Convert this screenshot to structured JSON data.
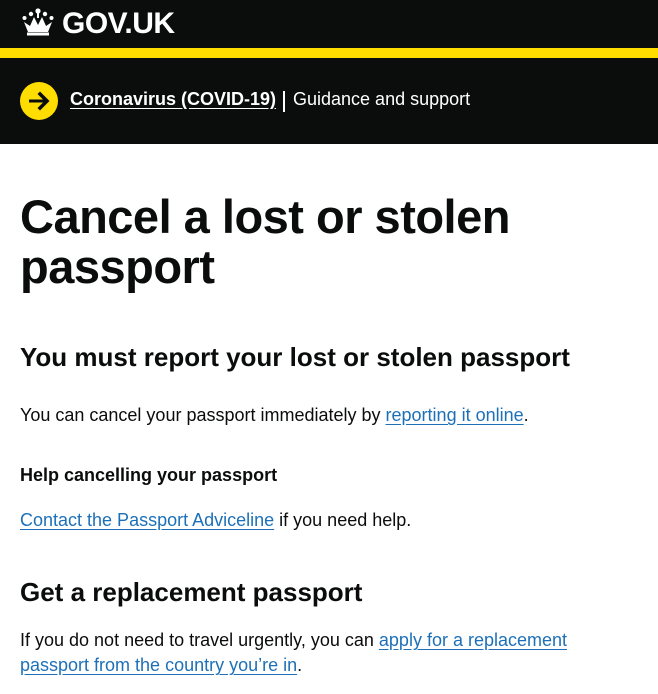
{
  "header": {
    "logo_text": "GOV.UK",
    "logo_icon": "crown-icon",
    "accent_color": "#ffdd00"
  },
  "covid_banner": {
    "icon": "arrow-right-icon",
    "link_text": "Coronavirus (COVID-19)",
    "description": "Guidance and support"
  },
  "page": {
    "title": "Cancel a lost or stolen passport",
    "sections": [
      {
        "heading": "You must report your lost or stolen passport",
        "paragraph": {
          "text_before": "You can cancel your passport immediately by ",
          "link_text": "reporting it online",
          "text_after": "."
        },
        "subheading": "Help cancelling your passport",
        "help_paragraph": {
          "link_text": "Contact the Passport Adviceline",
          "text_after": " if you need help."
        }
      },
      {
        "heading": "Get a replacement passport",
        "paragraph": {
          "text_before": "If you do not need to travel urgently, you can ",
          "link_text": "apply for a replacement passport from the country you’re in",
          "text_after": "."
        }
      }
    ]
  },
  "colors": {
    "link": "#1d70b8",
    "text": "#0b0c0c",
    "header_bg": "#0b0c0c"
  }
}
